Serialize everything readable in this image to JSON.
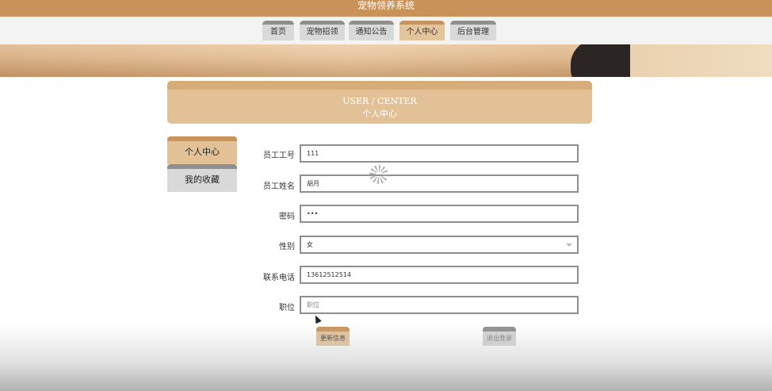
{
  "app": {
    "title": "宠物领养系统"
  },
  "nav": {
    "items": [
      {
        "label": "首页"
      },
      {
        "label": "宠物招领"
      },
      {
        "label": "通知公告"
      },
      {
        "label": "个人中心",
        "active": true
      },
      {
        "label": "后台管理"
      }
    ]
  },
  "header": {
    "title_en": "USER / CENTER",
    "title_cn": "个人中心"
  },
  "sidebar": {
    "items": [
      {
        "label": "个人中心",
        "active": true
      },
      {
        "label": "我的收藏"
      }
    ]
  },
  "form": {
    "employee_id": {
      "label": "员工工号",
      "value": "111"
    },
    "employee_name": {
      "label": "员工姓名",
      "value": "胡月"
    },
    "password": {
      "label": "密码",
      "value": "•••"
    },
    "gender": {
      "label": "性别",
      "value": "女"
    },
    "phone": {
      "label": "联系电话",
      "value": "13612512514"
    },
    "position": {
      "label": "职位",
      "placeholder": "职位"
    }
  },
  "actions": {
    "update_label": "更新信息",
    "logout_label": "退出登录"
  },
  "colors": {
    "accent": "#c99258",
    "accent_light": "#e2c196",
    "inactive": "#d9d9d9"
  }
}
